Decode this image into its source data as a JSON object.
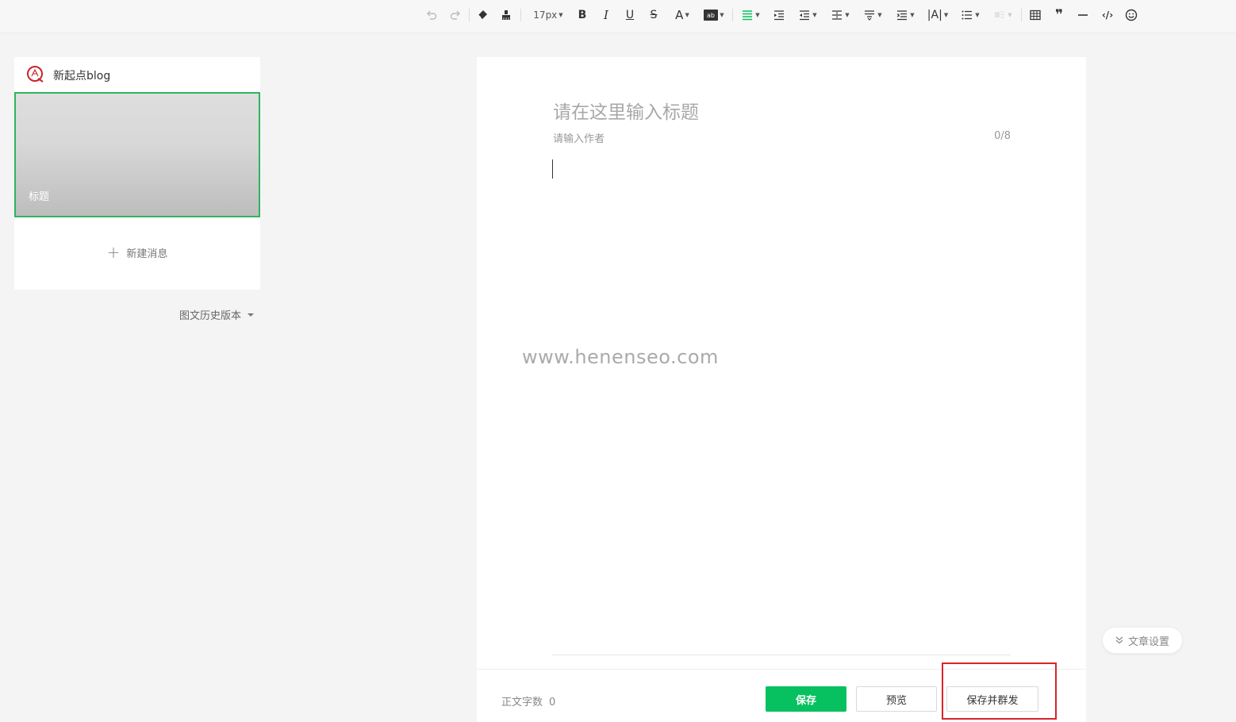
{
  "toolbar": {
    "font_size": "17px",
    "icons": [
      "undo-icon",
      "redo-icon",
      "eraser-icon",
      "format-brush-icon",
      "bold-icon",
      "italic-icon",
      "underline-icon",
      "strikethrough-icon",
      "font-color-icon",
      "background-color-icon",
      "align-icon",
      "indent-icon",
      "outdent-icon",
      "line-height-icon",
      "paragraph-spacing-before-icon",
      "paragraph-spacing-after-icon",
      "letter-spacing-icon",
      "list-icon",
      "disabled-format-icon",
      "table-icon",
      "quote-icon",
      "divider-icon",
      "code-icon",
      "emoji-icon"
    ],
    "accent": "#07c160"
  },
  "sidebar": {
    "account_name": "新起点blog",
    "cover_title": "标题",
    "new_message_label": "新建消息",
    "history_label": "图文历史版本"
  },
  "editor": {
    "title_placeholder": "请在这里输入标题",
    "author_placeholder": "请输入作者",
    "author_count": "0/8",
    "watermark": "www.henenseo.com"
  },
  "footer": {
    "word_count_label": "正文字数",
    "word_count_value": "0",
    "save_label": "保存",
    "preview_label": "预览",
    "publish_label": "保存并群发"
  },
  "settings": {
    "label": "文章设置"
  },
  "colors": {
    "primary_green": "#07c160",
    "highlight_red": "#d9232c",
    "selected_border": "#2eb55d"
  }
}
